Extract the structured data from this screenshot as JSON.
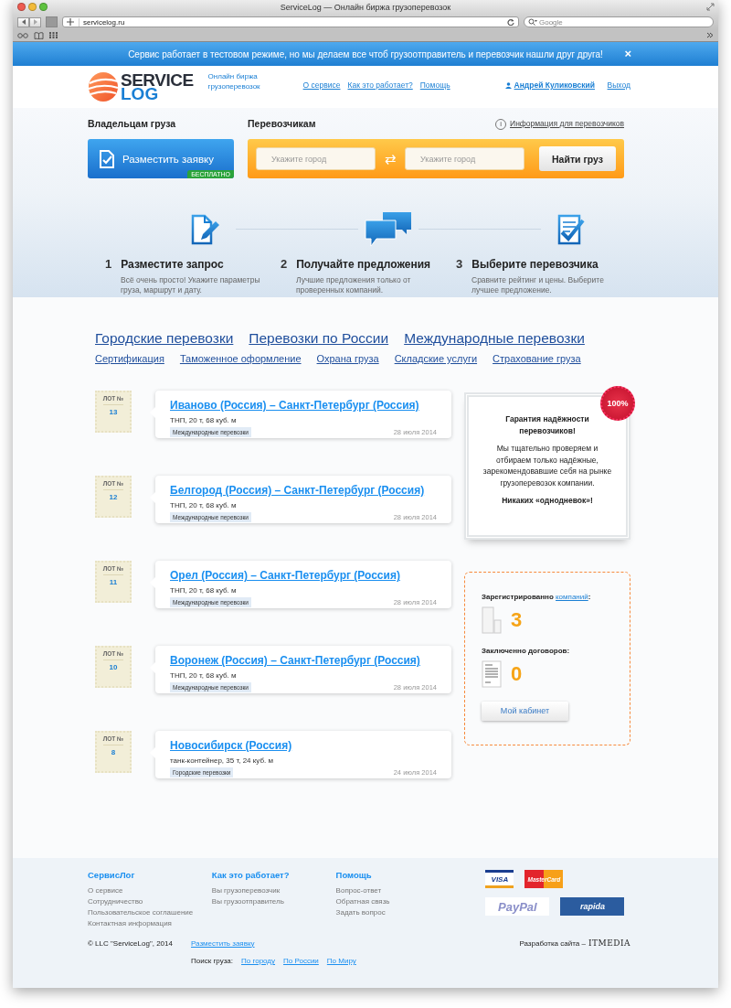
{
  "browser": {
    "title": "ServiceLog — Онлайн биржа грузоперевозок",
    "url": "servicelog.ru",
    "search_placeholder": "Google"
  },
  "notice": {
    "text": "Сервис работает в тестовом режиме, но мы делаем все чтоб грузоотправитель и перевозчик нашли друг друга!",
    "close": "×"
  },
  "header": {
    "logo_top": "SERVICE",
    "logo_bottom": "LOG",
    "tagline": "Онлайн биржа грузоперевозок",
    "nav": [
      "О сервисе",
      "Как это работает?",
      "Помощь"
    ],
    "user": "Андрей Куликовский",
    "logout": "Выход"
  },
  "owners": {
    "heading": "Владельцам груза",
    "button": "Разместить заявку",
    "ribbon": "БЕСПЛАТНО"
  },
  "carriers": {
    "heading": "Перевозчикам",
    "info_icon": "i",
    "info_link": "Информация для перевозчиков",
    "from_placeholder": "Укажите город",
    "swap": "⇄",
    "to_placeholder": "Укажите город",
    "button": "Найти груз"
  },
  "steps": [
    {
      "kind": "document",
      "number": "1",
      "title": "Разместите запрос",
      "text": "Всё очень просто! Укажите параметры груза, маршрут и дату."
    },
    {
      "kind": "chat",
      "number": "2",
      "title": "Получайте предложения",
      "text": "Лучшие предложения только от проверенных компаний."
    },
    {
      "kind": "checklist",
      "number": "3",
      "title": "Выберите перевозчика",
      "text": "Сравните рейтинг и цены. Выберите лучшее предложение."
    }
  ],
  "categories": {
    "primary": [
      "Городские перевозки",
      "Перевозки по России",
      "Международные перевозки"
    ],
    "secondary": [
      "Сертификация",
      "Таможенное оформление",
      "Охрана груза",
      "Складские услуги",
      "Страхование груза"
    ]
  },
  "lots": [
    {
      "lot_label": "ЛОТ №",
      "number": "13",
      "route": "Иваново (Россия) – Санкт-Петербург (Россия)",
      "cargo": "ТНП, 20 т, 68 куб. м",
      "tag": "Международные перевозки",
      "date": "28 июля 2014"
    },
    {
      "lot_label": "ЛОТ №",
      "number": "12",
      "route": "Белгород (Россия) – Санкт-Петербург (Россия)",
      "cargo": "ТНП, 20 т, 68 куб. м",
      "tag": "Международные перевозки",
      "date": "28 июля 2014"
    },
    {
      "lot_label": "ЛОТ №",
      "number": "11",
      "route": "Орел (Россия) – Санкт-Петербург (Россия)",
      "cargo": "ТНП, 20 т, 68 куб. м",
      "tag": "Международные перевозки",
      "date": "28 июля 2014"
    },
    {
      "lot_label": "ЛОТ №",
      "number": "10",
      "route": "Воронеж (Россия) – Санкт-Петербург (Россия)",
      "cargo": "ТНП, 20 т, 68 куб. м",
      "tag": "Международные перевозки",
      "date": "28 июля 2014"
    },
    {
      "lot_label": "ЛОТ №",
      "number": "8",
      "route": "Новосибирск (Россия)",
      "cargo": "танк-контейнер, 35 т, 24 куб. м",
      "tag": "Городские перевозки",
      "date": "24 июля 2014"
    }
  ],
  "guarantee": {
    "badge": "100%",
    "title": "Гарантия надёжности перевозчиков!",
    "text": "Мы тщательно проверяем и отбираем только надёжные, зарекомендовавшие себя на рынке грузоперевозок компании.",
    "footer": "Никаких «однодневок»!"
  },
  "stats": {
    "companies_label": "Зарегистрированно",
    "companies_link": "компаний",
    "companies_suffix": ":",
    "companies_count": "3",
    "contracts_label": "Заключенно договоров:",
    "contracts_count": "0",
    "button": "Мой кабинет"
  },
  "footer": {
    "columns": [
      {
        "title": "СервисЛог",
        "links": [
          "О сервисе",
          "Сотрудничество",
          "Пользовательское соглашение",
          "Контактная информация"
        ]
      },
      {
        "title": "Как это работает?",
        "links": [
          "Вы грузоперевозчик",
          "Вы грузоотправитель"
        ]
      },
      {
        "title": "Помощь",
        "links": [
          "Вопрос-ответ",
          "Обратная связь",
          "Задать вопрос"
        ]
      }
    ],
    "payments": [
      {
        "kind": "visa",
        "label": "VISA"
      },
      {
        "kind": "mastercard",
        "label": "MasterCard"
      },
      {
        "kind": "paypal",
        "label": "PayPal"
      },
      {
        "kind": "rapida",
        "label": "rapida"
      }
    ],
    "copyright": "© LLC \"ServiceLog\", 2014",
    "post_link": "Разместить заявку",
    "search_label": "Поиск груза:",
    "search_links": [
      "По городу",
      "По России",
      "По Миру"
    ],
    "developer": "Разработка сайта –",
    "developer_logo": "ITMEDIA"
  }
}
